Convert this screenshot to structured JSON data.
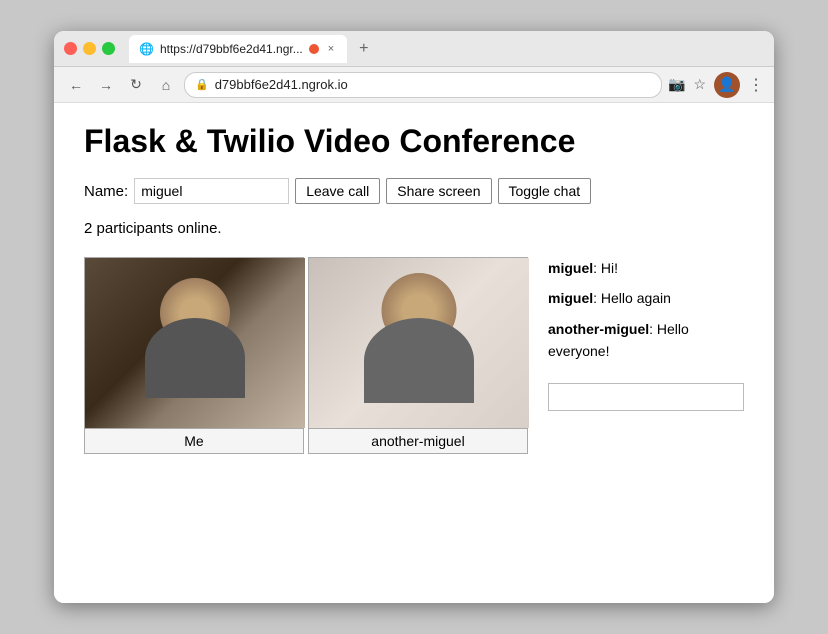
{
  "window": {
    "traffic_lights": [
      "red",
      "yellow",
      "green"
    ],
    "tab_url": "https://d79bbf6e2d41.ngr...",
    "tab_close": "×",
    "new_tab": "+"
  },
  "browser": {
    "back_arrow": "←",
    "forward_arrow": "→",
    "reload": "↻",
    "home": "⌂",
    "url": "d79bbf6e2d41.ngrok.io",
    "camera_icon": "📷",
    "star_icon": "☆",
    "more_icon": "⋮"
  },
  "page": {
    "title": "Flask & Twilio Video Conference",
    "name_label": "Name:",
    "name_value": "miguel",
    "name_placeholder": "miguel",
    "leave_call_label": "Leave call",
    "share_screen_label": "Share screen",
    "toggle_chat_label": "Toggle chat",
    "participants_text": "2 participants online."
  },
  "videos": [
    {
      "label": "Me"
    },
    {
      "label": "another-miguel"
    }
  ],
  "chat": {
    "messages": [
      {
        "username": "miguel",
        "text": "Hi!"
      },
      {
        "username": "miguel",
        "text": "Hello again"
      },
      {
        "username": "another-miguel",
        "text": "Hello everyone!"
      }
    ],
    "input_placeholder": ""
  }
}
